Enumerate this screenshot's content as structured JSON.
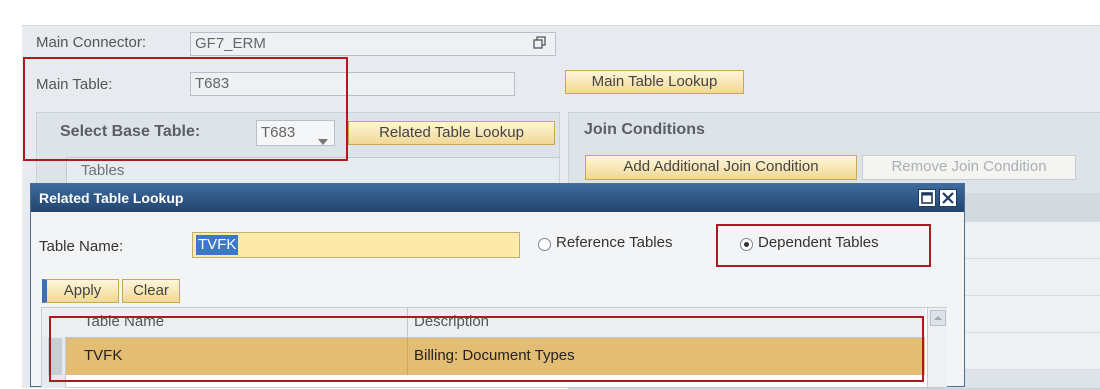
{
  "main_connector": {
    "label": "Main Connector:",
    "value": "GF7_ERM"
  },
  "main_table": {
    "label": "Main Table:",
    "value": "T683",
    "lookup_button": "Main Table Lookup"
  },
  "base_table": {
    "label": "Select Base Table:",
    "value": "T683",
    "related_button": "Related Table Lookup"
  },
  "tables_section": {
    "title": "Tables"
  },
  "join_conditions": {
    "title": "Join Conditions",
    "add_button": "Add Additional Join Condition",
    "remove_button": "Remove Join Condition"
  },
  "dialog": {
    "title": "Related Table Lookup",
    "table_name_label": "Table Name:",
    "table_name_value": "TVFK",
    "radio_reference": "Reference Tables",
    "radio_dependent": "Dependent Tables",
    "selected_radio": "Dependent Tables",
    "apply_button": "Apply",
    "clear_button": "Clear",
    "columns": [
      "Table Name",
      "Description"
    ],
    "rows": [
      {
        "table_name": "TVFK",
        "description": "Billing: Document Types",
        "selected": true
      }
    ]
  },
  "colors": {
    "highlight_red": "#b01820",
    "dialog_title": "#2f5684",
    "selected_row": "#e3bd73",
    "button_gold": "#f0d894"
  }
}
